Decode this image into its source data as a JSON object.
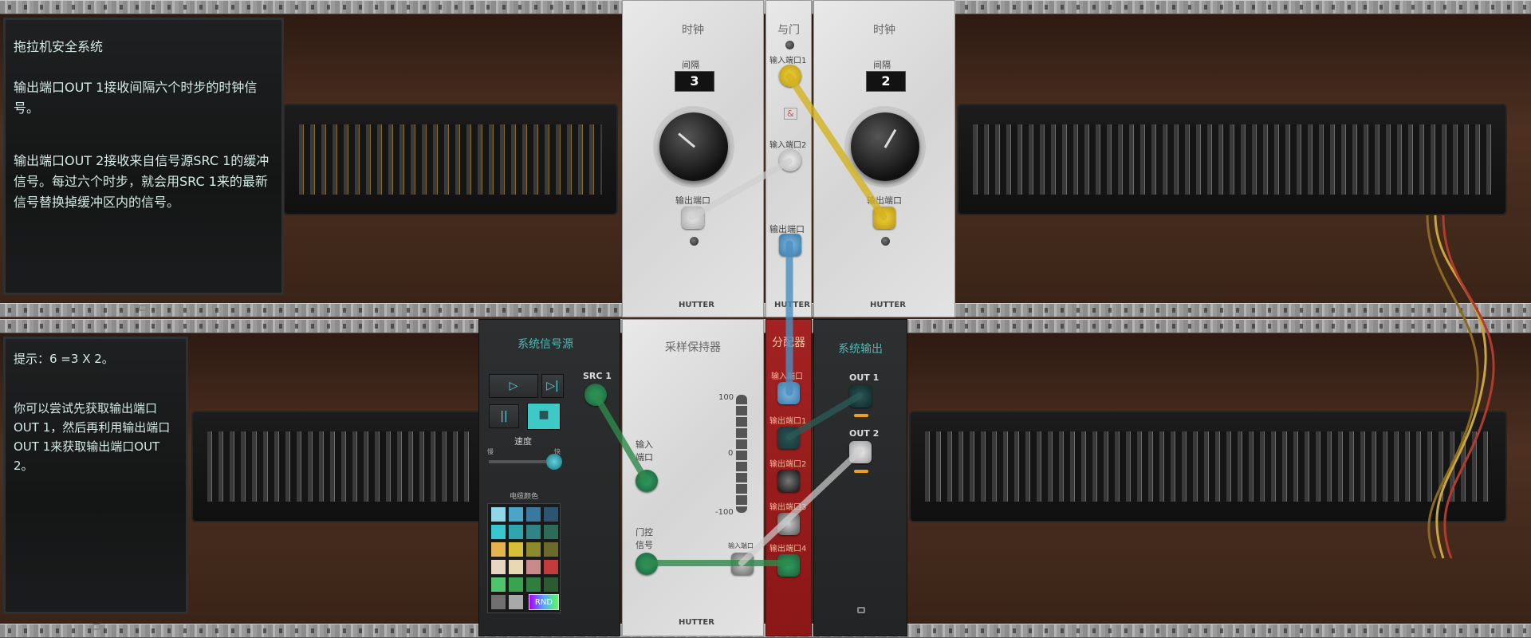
{
  "left_panel": {
    "title": "拖拉机安全系统",
    "para1": "输出端口OUT 1接收间隔六个时步的时钟信号。",
    "para2": " 输出端口OUT 2接收来自信号源SRC 1的缓冲信号。每过六个时步，就会用SRC 1来的最新信号替换掉缓冲区内的信号。",
    "hint_title": "提示：6 =3 X 2。",
    "hint_body": " 你可以尝试先获取输出端口OUT 1，然后再利用输出端口OUT 1来获取输出端口OUT 2。"
  },
  "clock1": {
    "title": "时钟",
    "interval_label": "间隔",
    "interval_value": "3",
    "out_label": "输出端口",
    "brand": "HUTTER"
  },
  "and_gate": {
    "title": "与门",
    "in1": "输入端口1",
    "in2": "输入端口2",
    "symbol": "&",
    "out_label": "输出端口",
    "brand": "HUTTER"
  },
  "clock2": {
    "title": "时钟",
    "interval_label": "间隔",
    "interval_value": "2",
    "out_label": "输出端口",
    "brand": "HUTTER"
  },
  "system_source": {
    "title": "系统信号源",
    "src1": "SRC 1",
    "speed_label": "速度",
    "speed_slow": "慢",
    "speed_fast": "快",
    "cable_color_label": "电缆颜色",
    "rnd_label": "RND",
    "swatches": [
      "#8fd6e8",
      "#4aa6c8",
      "#3a78a0",
      "#2b5570",
      "#38c7cf",
      "#2fa5b0",
      "#2f8585",
      "#2e6a5a",
      "#e4b24e",
      "#d9bf35",
      "#8c8a2a",
      "#6a6a2a",
      "#e9d6c2",
      "#e8d9b5",
      "#c98a8a",
      "#c33b3b",
      "#4fc46c",
      "#39a34f",
      "#2f7d3f",
      "#2b5a33",
      "#707070",
      "#a9a9a9"
    ]
  },
  "sample_hold": {
    "title": "采样保持器",
    "input_label": "输入\n端口",
    "gate_label": "门控\n信号",
    "scale_top": "100",
    "scale_mid": "0",
    "scale_bottom": "-100",
    "input_port_small": "输入端口",
    "brand": "HUTTER"
  },
  "distributor": {
    "title": "分配器",
    "input": "输入端口",
    "out1": "输出端口1",
    "out2": "输出端口2",
    "out3": "输出端口3",
    "out4": "输出端口4"
  },
  "system_output": {
    "title": "系统输出",
    "out1": "OUT 1",
    "out2": "OUT 2"
  },
  "colors": {
    "yellow_cable": "#d4b320",
    "blue_cable": "#4a8fc0",
    "green_cable": "#2f8a4c",
    "gray_cable": "#c8c8c8",
    "red_module": "#9b1d1d"
  }
}
